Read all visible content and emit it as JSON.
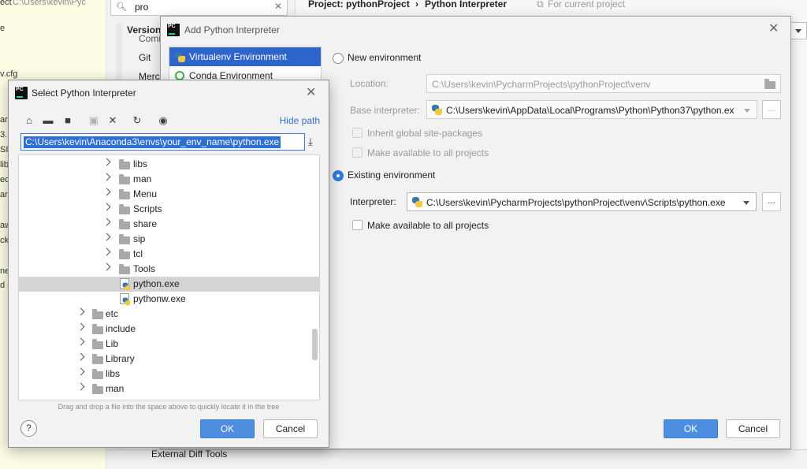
{
  "background": {
    "editor_fragments": [
      "ect",
      "C:\\Users\\kevin\\Pyc",
      "e",
      "v.cfg",
      "ari",
      "3.",
      "SI",
      "lib",
      "eci",
      "ar",
      "aw",
      "ck",
      "neo",
      "d C"
    ],
    "search": {
      "value": "pro"
    },
    "settings_tree": [
      "Version",
      "Comi",
      "Git",
      "Merc",
      "External Diff Tools"
    ],
    "breadcrumb": {
      "project": "Project: pythonProject",
      "separator": "›",
      "page": "Python Interpreter",
      "scope": "For current project"
    }
  },
  "add_dialog": {
    "title": "Add Python Interpreter",
    "env_types": [
      {
        "label": "Virtualenv Environment",
        "selected": true
      },
      {
        "label": "Conda Environment",
        "selected": false
      }
    ],
    "new_env": {
      "label": "New environment",
      "location_label": "Location:",
      "location_value": "C:\\Users\\kevin\\PycharmProjects\\pythonProject\\venv",
      "base_label": "Base interpreter:",
      "base_value": "C:\\Users\\kevin\\AppData\\Local\\Programs\\Python\\Python37\\python.ex",
      "inherit_label": "Inherit global site-packages",
      "make_available_label": "Make available to all projects"
    },
    "existing_env": {
      "label": "Existing environment",
      "selected": true,
      "interpreter_label": "Interpreter:",
      "interpreter_value": "C:\\Users\\kevin\\PycharmProjects\\pythonProject\\venv\\Scripts\\python.exe",
      "make_available_label": "Make available to all projects"
    },
    "ellipsis": "...",
    "ok": "OK",
    "cancel": "Cancel"
  },
  "select_dialog": {
    "title": "Select Python Interpreter",
    "hide_path": "Hide path",
    "path_value": "C:\\Users\\kevin\\Anaconda3\\envs\\your_env_name\\python.exe",
    "tree": [
      {
        "label": "libs",
        "kind": "folder",
        "level": 2
      },
      {
        "label": "man",
        "kind": "folder",
        "level": 2
      },
      {
        "label": "Menu",
        "kind": "folder",
        "level": 2
      },
      {
        "label": "Scripts",
        "kind": "folder",
        "level": 2
      },
      {
        "label": "share",
        "kind": "folder",
        "level": 2
      },
      {
        "label": "sip",
        "kind": "folder",
        "level": 2
      },
      {
        "label": "tcl",
        "kind": "folder",
        "level": 2
      },
      {
        "label": "Tools",
        "kind": "folder",
        "level": 2
      },
      {
        "label": "python.exe",
        "kind": "file",
        "level": 2,
        "selected": true
      },
      {
        "label": "pythonw.exe",
        "kind": "file",
        "level": 2
      },
      {
        "label": "etc",
        "kind": "folder",
        "level": 1
      },
      {
        "label": "include",
        "kind": "folder",
        "level": 1
      },
      {
        "label": "Lib",
        "kind": "folder",
        "level": 1
      },
      {
        "label": "Library",
        "kind": "folder",
        "level": 1
      },
      {
        "label": "libs",
        "kind": "folder",
        "level": 1
      },
      {
        "label": "man",
        "kind": "folder",
        "level": 1
      }
    ],
    "hint": "Drag and drop a file into the space above to quickly locate it in the tree",
    "help": "?",
    "ok": "OK",
    "cancel": "Cancel"
  }
}
